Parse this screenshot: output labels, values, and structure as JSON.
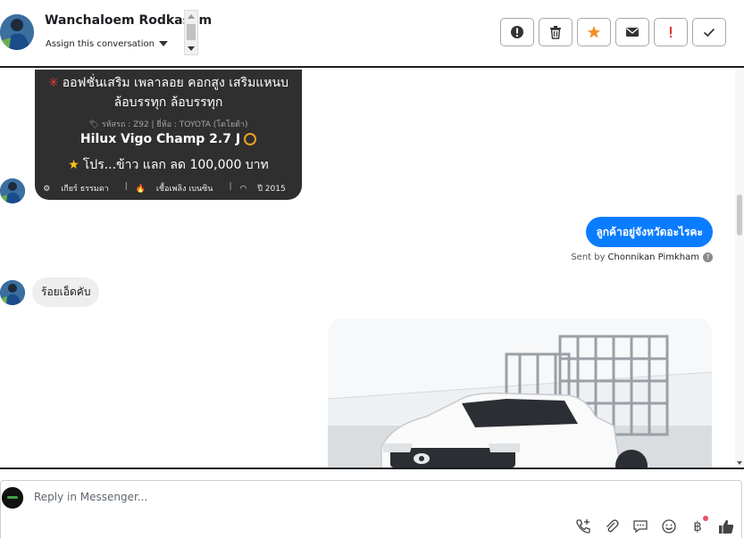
{
  "header": {
    "contact_name": "Wanchaloem Rodkasem",
    "assign_label": "Assign this conversation",
    "actions": [
      {
        "name": "mark-spam-icon",
        "color": "#333333"
      },
      {
        "name": "trash-icon",
        "color": "#333333"
      },
      {
        "name": "star-icon",
        "color": "#f0902b"
      },
      {
        "name": "envelope-icon",
        "color": "#333333"
      },
      {
        "name": "priority-icon",
        "color": "#e0352b"
      },
      {
        "name": "check-icon",
        "color": "#333333"
      }
    ]
  },
  "messages": {
    "promo": {
      "line1": "ออฟชั่นเสริม เพลาลอย คอกสูง เสริมแหนบ ล้อบรรทุก ล้อบรรทุก",
      "meta": "รหัสรถ : Z92 | ยี่ห้อ : TOYOTA (โตโยต้า)",
      "model": "Hilux Vigo Champ 2.7 J",
      "deal": "โปร...ข้าว แลก ลด 100,000 บาท",
      "spec_gear": "เกียร์ ธรรมดา",
      "spec_fuel": "เชื้อเพลิง เบนซิน",
      "spec_year": "ปี 2015"
    },
    "outgoing_text": "ลูกค้าอยู่จังหวัดอะไรคะ",
    "sent_by_prefix": "Sent by",
    "sent_by_name": "Chonnikan Pimkham",
    "incoming_text": "ร้อยเอ็ดคับ"
  },
  "composer": {
    "placeholder": "Reply in Messenger...",
    "tools": [
      "add-call-icon",
      "attachment-icon",
      "saved-reply-icon",
      "emoji-icon",
      "payment-icon",
      "like-icon"
    ],
    "payment_symbol": "฿"
  },
  "colors": {
    "outgoing_bubble": "#0a7cff",
    "incoming_bubble": "#eeeeee",
    "promo_bg": "#2f2f2f"
  }
}
